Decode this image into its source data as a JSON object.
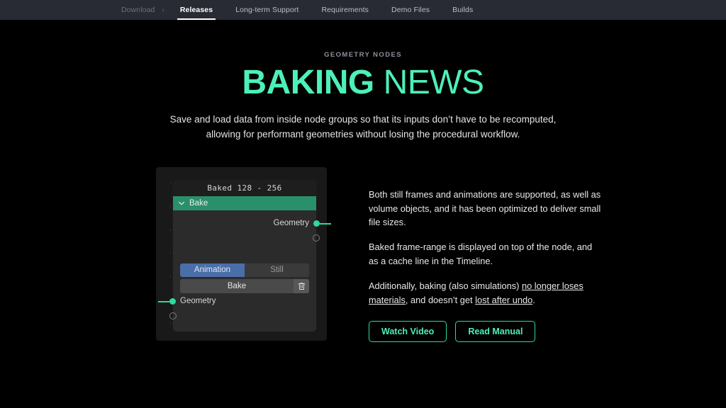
{
  "nav": {
    "items": [
      {
        "label": "Download",
        "state": "muted"
      },
      {
        "label": "Releases",
        "state": "active"
      },
      {
        "label": "Long-term Support",
        "state": "normal"
      },
      {
        "label": "Requirements",
        "state": "normal"
      },
      {
        "label": "Demo Files",
        "state": "normal"
      },
      {
        "label": "Builds",
        "state": "normal"
      }
    ],
    "separator": "›"
  },
  "hero": {
    "eyebrow": "GEOMETRY NODES",
    "title_bold": "BAKING",
    "title_light": " NEWS",
    "subtitle_line1": "Save and load data from inside node groups so that its inputs don’t have to be recomputed,",
    "subtitle_line2": "allowing for performant geometries without losing the procedural workflow."
  },
  "node": {
    "frame_label": "Baked 128 - 256",
    "header_title": "Bake",
    "output_socket_label": "Geometry",
    "input_socket_label": "Geometry",
    "toggle_animation": "Animation",
    "toggle_still": "Still",
    "bake_button": "Bake",
    "trash_icon": "trash-icon",
    "chevron_icon": "chevron-down-icon"
  },
  "copy": {
    "para1": "Both still frames and animations are supported, as well as volume objects, and it has been optimized to deliver small file sizes.",
    "para2": "Baked frame-range is displayed on top of the node, and as a cache line in the Timeline.",
    "para3_pre": "Additionally, baking (also simulations) ",
    "para3_link1": "no longer loses materials",
    "para3_mid": ", and doesn’t get ",
    "para3_link2": "lost after undo",
    "para3_post": ".",
    "watch_video": "Watch Video",
    "read_manual": "Read Manual"
  },
  "colors": {
    "accent": "#4df0b8",
    "socket": "#2ddb9a",
    "node_header": "#2a8f6b",
    "toggle_on": "#4a6ea8",
    "topbar": "#282b33",
    "background": "#000000"
  }
}
